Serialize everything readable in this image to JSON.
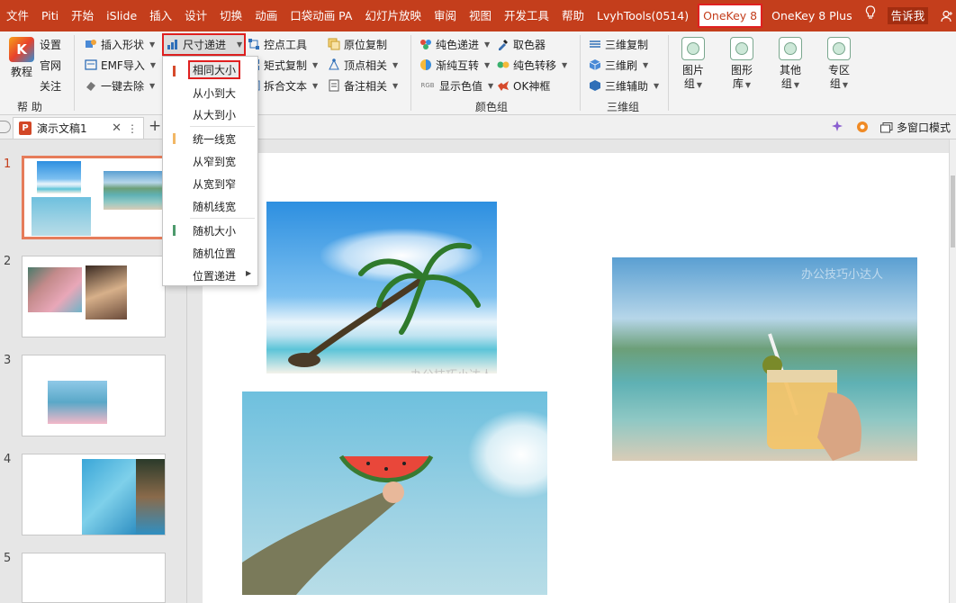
{
  "menubar": {
    "items": [
      "文件",
      "Piti",
      "开始",
      "iSlide",
      "插入",
      "设计",
      "切换",
      "动画",
      "口袋动画 PA",
      "幻灯片放映",
      "审阅",
      "视图",
      "开发工具",
      "帮助",
      "LvyhTools(0514)",
      "OneKey 8",
      "OneKey 8 Plus"
    ],
    "tell_me": "告诉我",
    "share": "共享"
  },
  "ribbon": {
    "help_group": {
      "tutorial": "教程",
      "settings": "设置",
      "website": "官网",
      "follow": "关注",
      "label": "帮 助"
    },
    "col1": {
      "insert_shape": "插入形状",
      "emf_import": "EMF导入",
      "one_key_remove": "一键去除"
    },
    "col2": {
      "size_progression": "尺寸递进"
    },
    "col3": {
      "anchor_tool": "控点工具",
      "matrix_copy": "矩式复制",
      "split_text": "拆合文本"
    },
    "col4": {
      "in_place_copy": "原位复制",
      "vertex_related": "顶点相关",
      "notes_related": "备注相关"
    },
    "color_group": {
      "label": "颜色组",
      "pure_progression": "纯色递进",
      "gradient_swap": "渐纯互转",
      "show_color_value": "显示色值",
      "color_picker": "取色器",
      "pure_transfer": "纯色转移",
      "ok_frame": "OK神框"
    },
    "3d_group": {
      "label": "三维组",
      "copy": "三维复制",
      "brush": "三维刷",
      "assist": "三维辅助"
    },
    "big_buttons": [
      {
        "line1": "图片",
        "line2": "组"
      },
      {
        "line1": "图形",
        "line2": "库"
      },
      {
        "line1": "其他",
        "line2": "组"
      },
      {
        "line1": "专区",
        "line2": "组"
      }
    ]
  },
  "tabbar": {
    "doc_name": "演示文稿1",
    "multi_window": "多窗口模式"
  },
  "slides": {
    "numbers": [
      "1",
      "2",
      "3",
      "4",
      "5"
    ]
  },
  "watermark": "办公技巧小达人",
  "dropdown": {
    "items": [
      "相同大小",
      "从小到大",
      "从大到小",
      "统一线宽",
      "从窄到宽",
      "从宽到窄",
      "随机线宽",
      "随机大小",
      "随机位置",
      "位置递进"
    ],
    "bar_colors": [
      "#d64a2c",
      "#f2b765",
      "#4d9a6c"
    ]
  },
  "colors": {
    "accent": "#c43e1c",
    "highlight_border": "#e02020",
    "selected_thumb": "#e67c5a"
  }
}
